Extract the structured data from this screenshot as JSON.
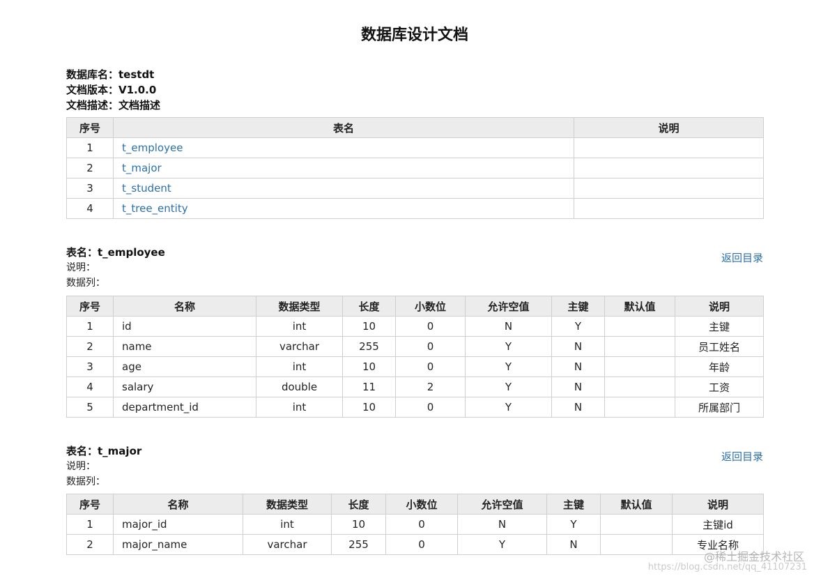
{
  "title": "数据库设计文档",
  "meta": {
    "db_name": "数据库名：testdt",
    "version": "文档版本：V1.0.0",
    "desc": "文档描述：文档描述"
  },
  "toc": {
    "headers": [
      "序号",
      "表名",
      "说明"
    ],
    "rows": [
      {
        "no": "1",
        "name": "t_employee",
        "desc": ""
      },
      {
        "no": "2",
        "name": "t_major",
        "desc": ""
      },
      {
        "no": "3",
        "name": "t_student",
        "desc": ""
      },
      {
        "no": "4",
        "name": "t_tree_entity",
        "desc": ""
      }
    ]
  },
  "back_label": "返回目录",
  "columns_headers": [
    "序号",
    "名称",
    "数据类型",
    "长度",
    "小数位",
    "允许空值",
    "主键",
    "默认值",
    "说明"
  ],
  "sections": [
    {
      "table_title": "表名：t_employee",
      "desc_line": "说明：",
      "cols_line": "数据列：",
      "rows": [
        [
          "1",
          "id",
          "int",
          "10",
          "0",
          "N",
          "Y",
          "",
          "主键"
        ],
        [
          "2",
          "name",
          "varchar",
          "255",
          "0",
          "Y",
          "N",
          "",
          "员工姓名"
        ],
        [
          "3",
          "age",
          "int",
          "10",
          "0",
          "Y",
          "N",
          "",
          "年龄"
        ],
        [
          "4",
          "salary",
          "double",
          "11",
          "2",
          "Y",
          "N",
          "",
          "工资"
        ],
        [
          "5",
          "department_id",
          "int",
          "10",
          "0",
          "Y",
          "N",
          "",
          "所属部门"
        ]
      ]
    },
    {
      "table_title": "表名：t_major",
      "desc_line": "说明：",
      "cols_line": "数据列：",
      "rows": [
        [
          "1",
          "major_id",
          "int",
          "10",
          "0",
          "N",
          "Y",
          "",
          "主键id"
        ],
        [
          "2",
          "major_name",
          "varchar",
          "255",
          "0",
          "Y",
          "N",
          "",
          "专业名称"
        ]
      ]
    }
  ],
  "watermark": "@稀土掘金技术社区",
  "watermark_url": "https://blog.csdn.net/qq_41107231"
}
